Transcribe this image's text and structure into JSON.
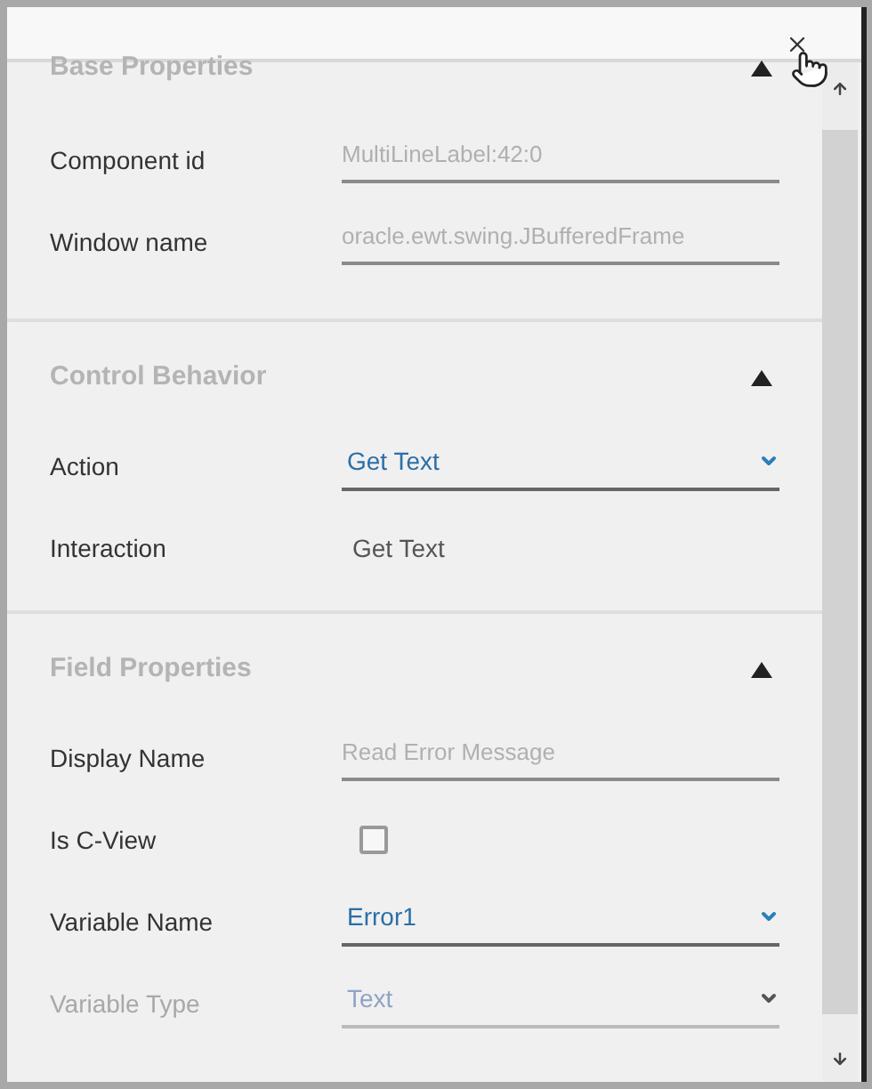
{
  "sections": [
    {
      "title": "Base Properties",
      "expanded": true,
      "rows": [
        {
          "label": "Component id",
          "kind": "text",
          "value": "MultiLineLabel:42:0",
          "disabled": false
        },
        {
          "label": "Window name",
          "kind": "text",
          "value": "oracle.ewt.swing.JBufferedFrame",
          "disabled": false
        }
      ]
    },
    {
      "title": "Control Behavior",
      "expanded": true,
      "rows": [
        {
          "label": "Action",
          "kind": "select",
          "value": "Get Text",
          "disabled": false
        },
        {
          "label": "Interaction",
          "kind": "static",
          "value": "Get Text",
          "disabled": false
        }
      ]
    },
    {
      "title": "Field Properties",
      "expanded": true,
      "rows": [
        {
          "label": "Display Name",
          "kind": "text",
          "value": "Read Error Message",
          "disabled": false
        },
        {
          "label": "Is C-View",
          "kind": "checkbox",
          "checked": false,
          "disabled": false
        },
        {
          "label": "Variable Name",
          "kind": "select",
          "value": "Error1",
          "disabled": false
        },
        {
          "label": "Variable Type",
          "kind": "select",
          "value": "Text",
          "disabled": true
        }
      ]
    }
  ]
}
